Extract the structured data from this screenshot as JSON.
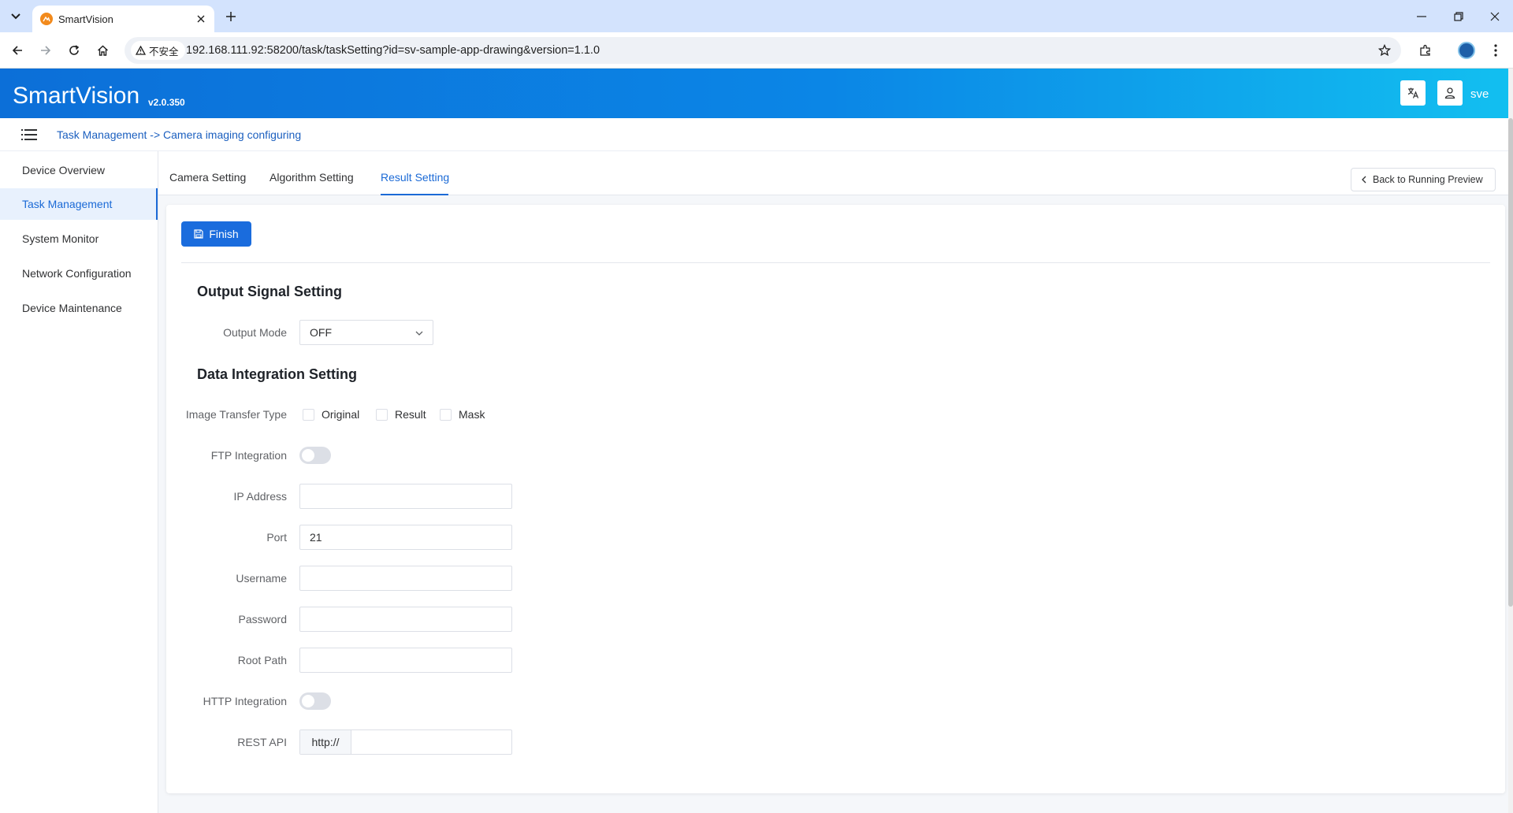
{
  "browser": {
    "tab_title": "SmartVision",
    "security_label": "不安全",
    "url": "192.168.111.92:58200/task/taskSetting?id=sv-sample-app-drawing&version=1.1.0"
  },
  "app": {
    "brand": "SmartVision",
    "version": "v2.0.350",
    "user": "sve",
    "accent_color": "#1a6cdd"
  },
  "breadcrumb": "Task Management -> Camera imaging configuring",
  "sidebar": {
    "items": [
      {
        "label": "Device Overview",
        "active": false
      },
      {
        "label": "Task Management",
        "active": true
      },
      {
        "label": "System Monitor",
        "active": false
      },
      {
        "label": "Network Configuration",
        "active": false
      },
      {
        "label": "Device Maintenance",
        "active": false
      }
    ]
  },
  "tabs": [
    {
      "label": "Camera Setting",
      "active": false
    },
    {
      "label": "Algorithm Setting",
      "active": false
    },
    {
      "label": "Result Setting",
      "active": true
    }
  ],
  "back_button": "Back to Running Preview",
  "finish_button": "Finish",
  "output_signal": {
    "title": "Output Signal Setting",
    "output_mode_label": "Output Mode",
    "output_mode_value": "OFF"
  },
  "data_integration": {
    "title": "Data Integration Setting",
    "image_transfer_label": "Image Transfer Type",
    "image_transfer_options": [
      {
        "label": "Original",
        "checked": false
      },
      {
        "label": "Result",
        "checked": false
      },
      {
        "label": "Mask",
        "checked": false
      }
    ],
    "ftp_label": "FTP Integration",
    "ftp_enabled": false,
    "ip_label": "IP Address",
    "ip_value": "",
    "port_label": "Port",
    "port_value": "21",
    "username_label": "Username",
    "username_value": "",
    "password_label": "Password",
    "password_value": "",
    "root_path_label": "Root Path",
    "root_path_value": "",
    "http_label": "HTTP Integration",
    "http_enabled": false,
    "rest_api_label": "REST API",
    "rest_api_prefix": "http://",
    "rest_api_value": ""
  }
}
